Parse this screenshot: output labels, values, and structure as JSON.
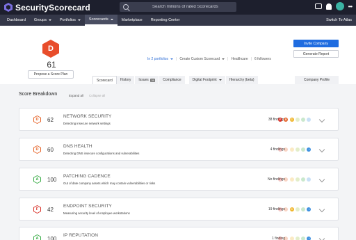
{
  "app": {
    "name": "SecurityScorecard"
  },
  "search": {
    "placeholder": "Search millions of rated Scorecards"
  },
  "nav": {
    "items": [
      "Dashboard",
      "Groups",
      "Portfolios",
      "Scorecards",
      "Marketplace",
      "Reporting Center"
    ],
    "right": "Switch To Atlas"
  },
  "company": {
    "grade": "D",
    "score": "61",
    "plan_button": "Propose a Score Plan",
    "portfolios_link": "In 2 portfolios",
    "custom_scorecard": "Create Custom Scorecard",
    "industry": "Healthcare",
    "followers": "6 followers"
  },
  "actions": {
    "invite": "Invite Company",
    "report": "Generate Report"
  },
  "tabs": {
    "scorecard": "Scorecard",
    "history": "History",
    "issues": "Issues",
    "issues_count": "28",
    "compliance": "Compliance",
    "footprint": "Digital Footprint",
    "hierarchy": "Hierarchy (beta)",
    "profile": "Company Profile"
  },
  "breakdown": {
    "title": "Score Breakdown",
    "expand": "Expand all",
    "collapse": "Collapse all"
  },
  "colors": {
    "A": "#3dae4a",
    "B": "#9bc23f",
    "C": "#f0b52a",
    "D": "#e6662c",
    "F": "#d9342b",
    "info": "#3b8fe0"
  },
  "factors": [
    {
      "grade": "D",
      "score": "62",
      "name": "NETWORK SECURITY",
      "desc": "Detecting insecure network settings",
      "findings": "38 findings",
      "dots": [
        {
          "l": "F",
          "c": "F"
        },
        {
          "l": "D",
          "c": "D"
        },
        {
          "l": "C",
          "c": "C"
        },
        {
          "l": "",
          "c": "B"
        },
        {
          "l": "",
          "c": "A"
        },
        {
          "l": "",
          "c": "info"
        }
      ]
    },
    {
      "grade": "D",
      "score": "60",
      "name": "DNS HEALTH",
      "desc": "Detecting DNS insecure configurations and vulnerabilities",
      "findings": "4 findings",
      "dots": [
        {
          "l": "",
          "c": "F"
        },
        {
          "l": "",
          "c": "D"
        },
        {
          "l": "",
          "c": "C"
        },
        {
          "l": "",
          "c": "B"
        },
        {
          "l": "",
          "c": "A"
        },
        {
          "l": "i",
          "c": "info"
        }
      ]
    },
    {
      "grade": "A",
      "score": "100",
      "name": "PATCHING CADENCE",
      "desc": "Out of date company assets which may contain vulnerabilities or risks",
      "findings": "No findings",
      "dots": [
        {
          "l": "",
          "c": "F"
        },
        {
          "l": "",
          "c": "D"
        },
        {
          "l": "",
          "c": "C"
        },
        {
          "l": "",
          "c": "B"
        },
        {
          "l": "",
          "c": "A"
        },
        {
          "l": "",
          "c": "info"
        }
      ]
    },
    {
      "grade": "F",
      "score": "42",
      "name": "ENDPOINT SECURITY",
      "desc": "Measuring security level of employee workstations",
      "findings": "19 findings",
      "dots": [
        {
          "l": "",
          "c": "F"
        },
        {
          "l": "",
          "c": "D"
        },
        {
          "l": "C",
          "c": "C"
        },
        {
          "l": "",
          "c": "B"
        },
        {
          "l": "",
          "c": "A"
        },
        {
          "l": "i",
          "c": "info"
        }
      ]
    },
    {
      "grade": "A",
      "score": "100",
      "name": "IP REPUTATION",
      "desc": "Detecting suspicious activity, such as malware or spam, within your company network",
      "findings": "1 finding",
      "dots": [
        {
          "l": "",
          "c": "F"
        },
        {
          "l": "",
          "c": "D"
        },
        {
          "l": "",
          "c": "C"
        },
        {
          "l": "",
          "c": "B"
        },
        {
          "l": "",
          "c": "A"
        },
        {
          "l": "i",
          "c": "info"
        }
      ]
    }
  ]
}
